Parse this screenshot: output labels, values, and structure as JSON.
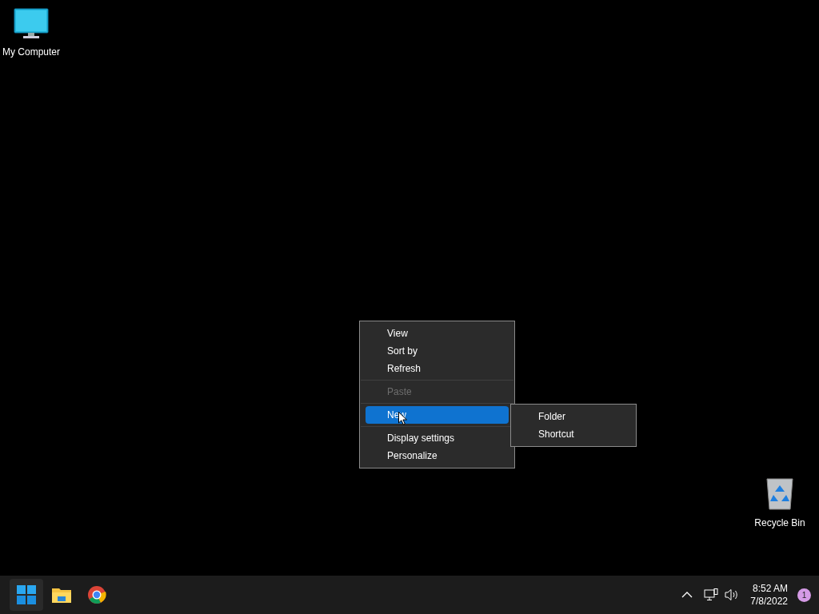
{
  "desktop_icons": [
    {
      "label": "My Computer",
      "kind": "computer"
    },
    {
      "label": "Recycle Bin",
      "kind": "recycle"
    }
  ],
  "context_menu": {
    "items": [
      {
        "kind": "item",
        "label": "View",
        "disabled": false,
        "selected": false
      },
      {
        "kind": "item",
        "label": "Sort by",
        "disabled": false,
        "selected": false
      },
      {
        "kind": "item",
        "label": "Refresh",
        "disabled": false,
        "selected": false
      },
      {
        "kind": "separator"
      },
      {
        "kind": "item",
        "label": "Paste",
        "disabled": true,
        "selected": false
      },
      {
        "kind": "separator"
      },
      {
        "kind": "item",
        "label": "New",
        "disabled": false,
        "selected": true
      },
      {
        "kind": "separator"
      },
      {
        "kind": "item",
        "label": "Display settings",
        "disabled": false,
        "selected": false
      },
      {
        "kind": "item",
        "label": "Personalize",
        "disabled": false,
        "selected": false
      }
    ]
  },
  "submenu": {
    "items": [
      {
        "label": "Folder"
      },
      {
        "label": "Shortcut"
      }
    ]
  },
  "taskbar": {
    "apps": [
      {
        "kind": "start",
        "selected": true
      },
      {
        "kind": "files",
        "selected": false
      },
      {
        "kind": "browser",
        "selected": false
      }
    ],
    "clock": {
      "time": "8:52 AM",
      "date": "7/8/2022"
    },
    "notification_count": "1"
  }
}
